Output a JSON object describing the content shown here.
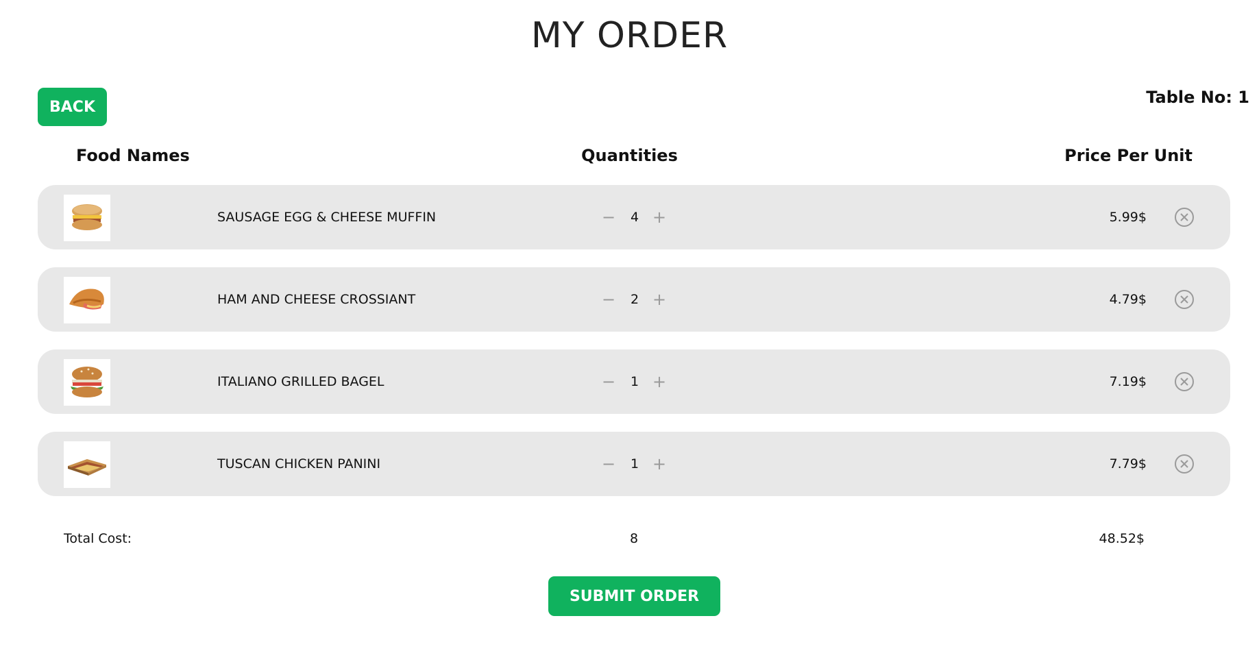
{
  "header": {
    "title": "MY ORDER",
    "back_label": "BACK",
    "table_label": "Table No:",
    "table_number": "1"
  },
  "columns": {
    "food": "Food Names",
    "quantity": "Quantities",
    "price": "Price Per Unit"
  },
  "items": [
    {
      "name": "SAUSAGE EGG & CHEESE MUFFIN",
      "quantity": "4",
      "price": "5.99$",
      "thumb": "muffin-sandwich"
    },
    {
      "name": "HAM AND CHEESE CROSSIANT",
      "quantity": "2",
      "price": "4.79$",
      "thumb": "croissant-sandwich"
    },
    {
      "name": "ITALIANO GRILLED BAGEL",
      "quantity": "1",
      "price": "7.19$",
      "thumb": "bagel-sandwich"
    },
    {
      "name": "TUSCAN CHICKEN PANINI",
      "quantity": "1",
      "price": "7.79$",
      "thumb": "panini-sandwich"
    }
  ],
  "controls": {
    "minus_symbol": "−",
    "plus_symbol": "+",
    "remove_icon": "circle-x-icon"
  },
  "totals": {
    "label": "Total Cost:",
    "quantity": "8",
    "price": "48.52$"
  },
  "footer": {
    "submit_label": "SUBMIT ORDER"
  },
  "colors": {
    "accent": "#10b25e",
    "row_background": "#e8e8e8",
    "muted_icon": "#9a9a9a"
  }
}
